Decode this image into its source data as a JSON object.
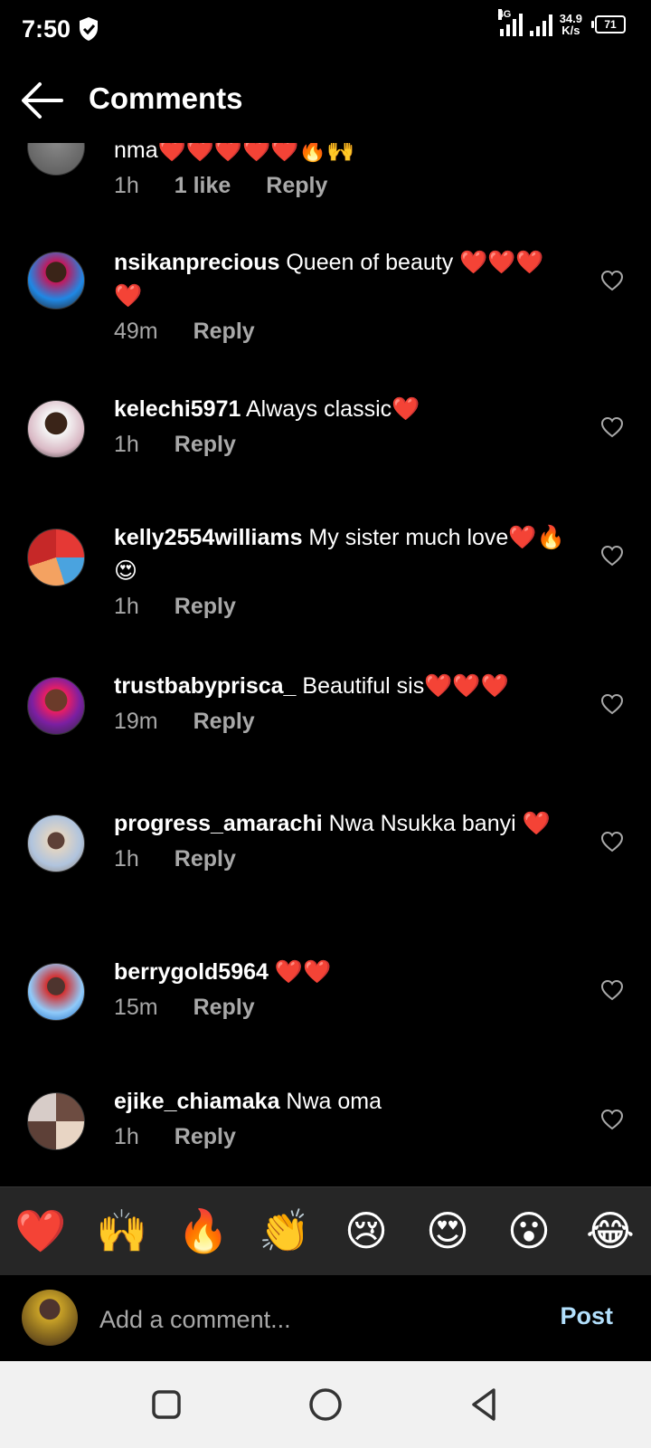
{
  "status": {
    "time": "7:50",
    "network_label": "4G",
    "speed_value": "34.9",
    "speed_unit": "K/s",
    "battery": "71"
  },
  "header": {
    "title": "Comments"
  },
  "comments": [
    {
      "username": "",
      "text": "nma❤️❤️❤️❤️❤️🔥🙌",
      "time": "1h",
      "likes": "1 like",
      "reply": "Reply"
    },
    {
      "username": "nsikanprecious",
      "text": " Queen of beauty ❤️❤️❤️❤️",
      "time": "49m",
      "reply": "Reply"
    },
    {
      "username": "kelechi5971",
      "text": " Always classic❤️",
      "time": "1h",
      "reply": "Reply"
    },
    {
      "username": "kelly2554williams",
      "text": " My sister much love❤️🔥😍",
      "time": "1h",
      "reply": "Reply"
    },
    {
      "username": "trustbabyprisca_",
      "text": " Beautiful sis❤️❤️❤️",
      "time": "19m",
      "reply": "Reply"
    },
    {
      "username": "progress_amarachi",
      "text": " Nwa Nsukka banyi ❤️",
      "time": "1h",
      "reply": "Reply"
    },
    {
      "username": "berrygold5964",
      "text": " ❤️❤️",
      "time": "15m",
      "reply": "Reply"
    },
    {
      "username": "ejike_chiamaka",
      "text": " Nwa oma",
      "time": "1h",
      "reply": "Reply"
    }
  ],
  "reactions": [
    "❤️",
    "🙌",
    "🔥",
    "👏",
    "😢",
    "😍",
    "😮",
    "😂"
  ],
  "composer": {
    "placeholder": "Add a comment...",
    "post_label": "Post"
  },
  "colors": {
    "background": "#000000",
    "secondary_text": "#a8a8a8",
    "post_button": "#b2dffc",
    "emoji_bar": "#262626",
    "nav_bar": "#f1f1f1"
  }
}
